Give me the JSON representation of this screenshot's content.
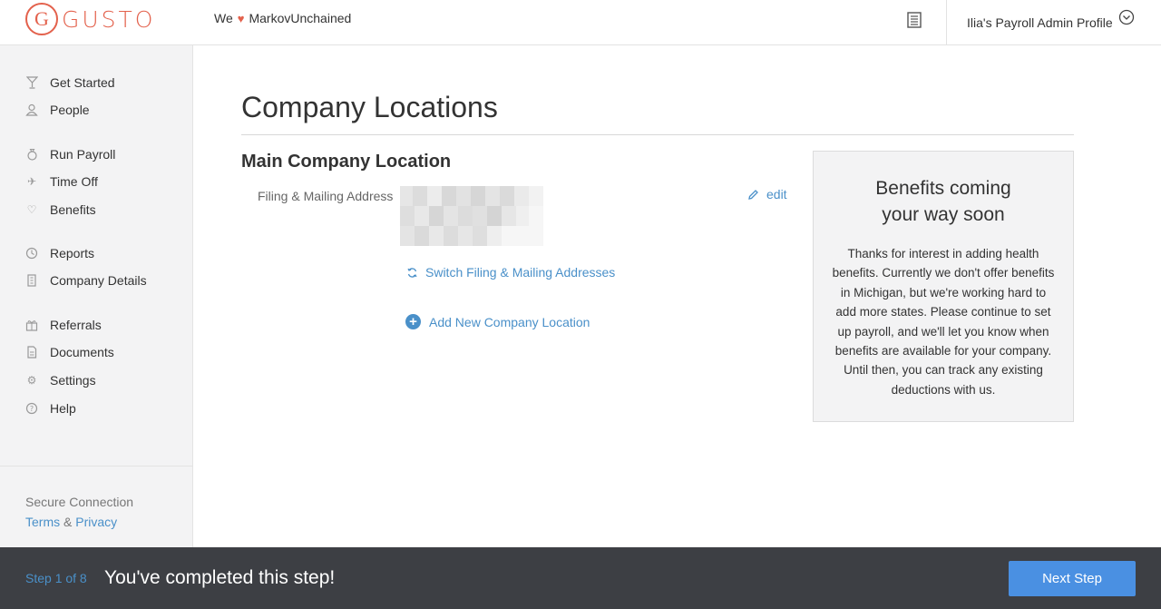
{
  "header": {
    "logo_letter": "G",
    "logo_text": "GUSTO",
    "tagline_prefix": "We",
    "tagline_company": "MarkovUnchained",
    "profile_label": "Ilia's Payroll Admin Profile"
  },
  "sidebar": {
    "items": [
      {
        "label": "Get Started",
        "icon": "cocktail-icon"
      },
      {
        "label": "People",
        "icon": "person-icon"
      },
      {
        "label": "Run Payroll",
        "icon": "money-bag-icon"
      },
      {
        "label": "Time Off",
        "icon": "airplane-icon"
      },
      {
        "label": "Benefits",
        "icon": "heart-icon"
      },
      {
        "label": "Reports",
        "icon": "clock-icon"
      },
      {
        "label": "Company Details",
        "icon": "building-icon"
      },
      {
        "label": "Referrals",
        "icon": "gift-icon"
      },
      {
        "label": "Documents",
        "icon": "document-icon"
      },
      {
        "label": "Settings",
        "icon": "gear-icon"
      },
      {
        "label": "Help",
        "icon": "question-icon"
      }
    ],
    "footer": {
      "secure": "Secure Connection",
      "terms": "Terms",
      "amp": "&",
      "privacy": "Privacy"
    }
  },
  "main": {
    "title": "Company Locations",
    "section_title": "Main Company Location",
    "address_label": "Filing & Mailing Address",
    "edit_label": "edit",
    "switch_label": "Switch Filing & Mailing Addresses",
    "add_label": "Add New Company Location"
  },
  "benefits_card": {
    "title_line1": "Benefits coming",
    "title_line2": "your way soon",
    "body": "Thanks for interest in adding health benefits. Currently we don't offer benefits in Michigan, but we're working hard to add more states. Please continue to set up payroll, and we'll let you know when benefits are available for your company. Until then, you can track any existing deductions with us."
  },
  "footer_bar": {
    "step": "Step 1 of 8",
    "message": "You've completed this step!",
    "next_button": "Next Step"
  },
  "colors": {
    "brand": "#e3614c",
    "link": "#4a90c9",
    "bar": "#3d3f44",
    "button": "#4a90e2"
  }
}
